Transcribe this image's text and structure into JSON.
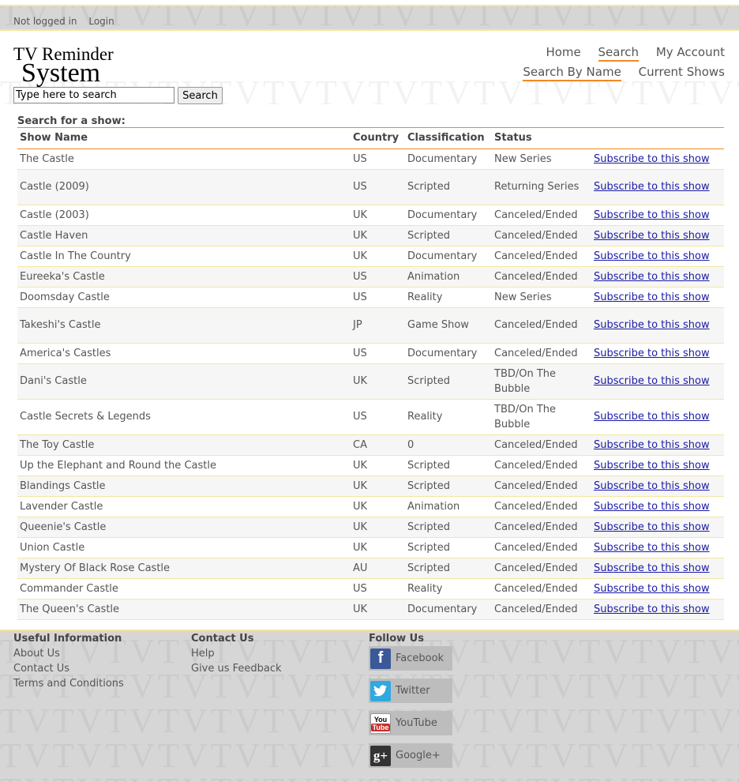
{
  "topbar": {
    "status": "Not logged in",
    "login": "Login"
  },
  "logo": {
    "line1": "TV Reminder",
    "line2": "System"
  },
  "nav": {
    "primary": [
      "Home",
      "Search",
      "My Account"
    ],
    "secondary": [
      "Search By Name",
      "Current Shows"
    ]
  },
  "search": {
    "placeholder": "Type here to search",
    "button": "Search"
  },
  "results": {
    "heading": "Search for a show:",
    "columns": [
      "Show Name",
      "Country",
      "Classification",
      "Status",
      ""
    ],
    "link_text": "Subscribe to this show",
    "rows": [
      [
        "The Castle",
        "US",
        "Documentary",
        "New Series"
      ],
      [
        "Castle (2009)",
        "US",
        "Scripted",
        "Returning Series"
      ],
      [
        "Castle (2003)",
        "UK",
        "Documentary",
        "Canceled/Ended"
      ],
      [
        "Castle Haven",
        "UK",
        "Scripted",
        "Canceled/Ended"
      ],
      [
        "Castle In The Country",
        "UK",
        "Documentary",
        "Canceled/Ended"
      ],
      [
        "Eureeka's Castle",
        "US",
        "Animation",
        "Canceled/Ended"
      ],
      [
        "Doomsday Castle",
        "US",
        "Reality",
        "New Series"
      ],
      [
        "Takeshi's Castle",
        "JP",
        "Game Show",
        "Canceled/Ended"
      ],
      [
        "America's Castles",
        "US",
        "Documentary",
        "Canceled/Ended"
      ],
      [
        "Dani's Castle",
        "UK",
        "Scripted",
        "TBD/On The Bubble"
      ],
      [
        "Castle Secrets & Legends",
        "US",
        "Reality",
        "TBD/On The Bubble"
      ],
      [
        "The Toy Castle",
        "CA",
        "0",
        "Canceled/Ended"
      ],
      [
        "Up the Elephant and Round the Castle",
        "UK",
        "Scripted",
        "Canceled/Ended"
      ],
      [
        "Blandings Castle",
        "UK",
        "Scripted",
        "Canceled/Ended"
      ],
      [
        "Lavender Castle",
        "UK",
        "Animation",
        "Canceled/Ended"
      ],
      [
        "Queenie's Castle",
        "UK",
        "Scripted",
        "Canceled/Ended"
      ],
      [
        "Union Castle",
        "UK",
        "Scripted",
        "Canceled/Ended"
      ],
      [
        "Mystery Of Black Rose Castle",
        "AU",
        "Scripted",
        "Canceled/Ended"
      ],
      [
        "Commander Castle",
        "US",
        "Reality",
        "Canceled/Ended"
      ],
      [
        "The Queen's Castle",
        "UK",
        "Documentary",
        "Canceled/Ended"
      ]
    ]
  },
  "footer": {
    "useful": {
      "heading": "Useful Information",
      "items": [
        "About Us",
        "Contact Us",
        "Terms and Conditions"
      ]
    },
    "contact": {
      "heading": "Contact Us",
      "items": [
        "Help",
        "Give us Feedback"
      ]
    },
    "follow": {
      "heading": "Follow Us",
      "items": [
        {
          "label": "Facebook",
          "icon": "facebook-icon",
          "color": "#3b5998"
        },
        {
          "label": "Twitter",
          "icon": "twitter-icon",
          "color": "#2fa9e0"
        },
        {
          "label": "YouTube",
          "icon": "youtube-icon",
          "color": "#c4302b"
        },
        {
          "label": "Google+",
          "icon": "google-plus-icon",
          "color": "#333333"
        }
      ]
    }
  },
  "colors": {
    "accent": "#f08a24",
    "divider": "#f3e6a1",
    "link": "#1a1aa6",
    "footer_bg": "#d6d6d6"
  }
}
